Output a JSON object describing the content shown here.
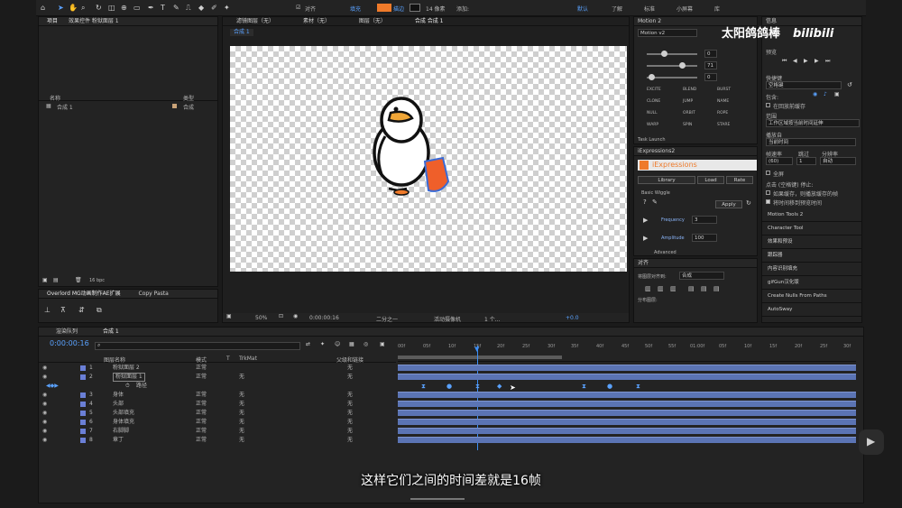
{
  "toolbar": {
    "align_label": "对齐",
    "fill_label": "填充",
    "stroke_label": "描边",
    "stroke_width": "14 像素",
    "add_label": "添加:",
    "fill_color": "#ef7a2a",
    "workspace_items": [
      "默认",
      "了解",
      "标准",
      "小屏幕",
      "库"
    ]
  },
  "watermark": {
    "channel": "太阳鸽鸽棒",
    "brand": "bilibili"
  },
  "project": {
    "tabs": [
      "项目",
      "效果控件 粉狱面层 1"
    ],
    "col_name": "名称",
    "col_type": "类型",
    "items": [
      {
        "name": "合成 1",
        "type": "合成"
      }
    ],
    "footer_bpc": "16 bpc"
  },
  "overlord": {
    "tab1": "Overlord MG动画制作AE扩展",
    "tab2": "Copy Pasta"
  },
  "viewer": {
    "top_tabs": [
      "滤镜图层（无）",
      "素材（无）",
      "图层（无）",
      "合成 合成 1"
    ],
    "comp_tab": "合成 1",
    "zoom": "50%",
    "time": "0:00:00:16",
    "resolution": "二分之一",
    "camera": "活动摄像机",
    "views": "1 个...",
    "exposure": "+0.0"
  },
  "motion2": {
    "title": "Motion 2",
    "version": "Motion v2",
    "slider_values": [
      "0",
      "71",
      "0"
    ],
    "buttons": [
      "EXCITE",
      "BLEND",
      "BURST",
      "CLONE",
      "JUMP",
      "NAME",
      "NULL",
      "ORBIT",
      "ROPE",
      "WARP",
      "SPIN",
      "STARE"
    ],
    "footer": "Task Launch"
  },
  "iexpr": {
    "panel_title": "iExpressions2",
    "brand": "iExpressions",
    "tabs": [
      "Library",
      "Load",
      "Rate"
    ],
    "section": "Basic Wiggle",
    "apply": "Apply",
    "freq_label": "Frequency",
    "freq_value": "3",
    "amp_label": "Amplitude",
    "amp_value": "100",
    "advanced": "Advanced"
  },
  "align": {
    "title": "对齐",
    "align_to_label": "将图层对齐到:",
    "align_to_value": "合成",
    "distribute_label": "分布图层:"
  },
  "right": {
    "info": "信息",
    "preview": "预览",
    "shortcut_label": "快捷键",
    "shortcut_value": "空格键",
    "include_label": "包含:",
    "cache_check": "在回放前缓存",
    "range_label": "范围",
    "range_value": "工作区域按当前时间延伸",
    "play_from_label": "播放自",
    "play_from_value": "当前时间",
    "fps_label": "帧速率",
    "skip_label": "跳过",
    "res_label": "分辨率",
    "fps_value": "(60)",
    "skip_value": "1",
    "res_value": "自动",
    "fullscreen": "全屏",
    "on_stop": "点击 (空格键) 停止:",
    "cache_opt": "如果缓存，则播放缓存的帧",
    "move_time": "将时间移到预览时间",
    "menu": [
      "Motion Tools 2",
      "Character Tool",
      "效果和预设",
      "跟踪器",
      "内容识别填充",
      "gifGun汉化版",
      "Create Nulls From Paths",
      "AutoSway"
    ]
  },
  "timeline": {
    "tabs": [
      "渲染队列",
      "合成 1"
    ],
    "timecode": "0:00:00:16",
    "col_name": "图层名称",
    "col_mode": "模式",
    "col_t": "T",
    "col_trkmat": "TrkMat",
    "col_parent": "父级和链接",
    "sub_property": "路径",
    "ruler": [
      "00f",
      "05f",
      "10f",
      "15f",
      "20f",
      "25f",
      "30f",
      "35f",
      "40f",
      "45f",
      "50f",
      "55f",
      "01:00f",
      "05f",
      "10f",
      "15f",
      "20f",
      "25f",
      "30f"
    ],
    "layers": [
      {
        "num": "1",
        "name": "粉狱面层 2",
        "mode": "正常",
        "trk": "",
        "parent": "无"
      },
      {
        "num": "2",
        "name": "粉狱面层 1",
        "mode": "正常",
        "trk": "无",
        "parent": "无"
      },
      {
        "num": "3",
        "name": "身体",
        "mode": "正常",
        "trk": "无",
        "parent": "无"
      },
      {
        "num": "4",
        "name": "头部",
        "mode": "正常",
        "trk": "无",
        "parent": "无"
      },
      {
        "num": "5",
        "name": "头部填充",
        "mode": "正常",
        "trk": "无",
        "parent": "无"
      },
      {
        "num": "6",
        "name": "身体填充",
        "mode": "正常",
        "trk": "无",
        "parent": "无"
      },
      {
        "num": "7",
        "name": "右脚脚",
        "mode": "正常",
        "trk": "无",
        "parent": "无"
      },
      {
        "num": "8",
        "name": "章丁",
        "mode": "正常",
        "trk": "无",
        "parent": "无"
      }
    ]
  },
  "subtitle": "这样它们之间的时间差就是16帧"
}
